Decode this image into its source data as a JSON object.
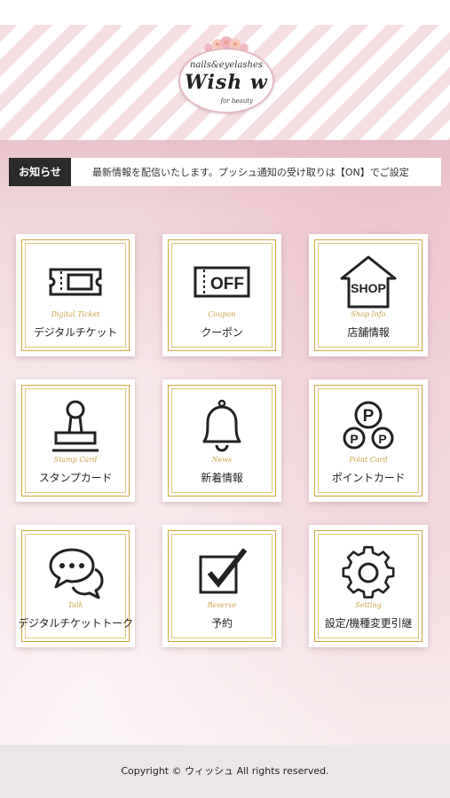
{
  "logo": {
    "small_text": "nails&eyelashes",
    "main_text": "Wish w",
    "sub_text": "for beauty"
  },
  "ticker": {
    "label": "お知らせ",
    "text": "最新情報を配信いたします。プッシュ通知の受け取りは【ON】でご設定"
  },
  "tiles": [
    {
      "en": "Digital Ticket",
      "jp": "デジタルチケット",
      "icon": "ticket-icon"
    },
    {
      "en": "Coupon",
      "jp": "クーポン",
      "icon": "off-coupon-icon",
      "icon_text": "OFF"
    },
    {
      "en": "Shop Info",
      "jp": "店舗情報",
      "icon": "shop-house-icon",
      "icon_text": "SHOP"
    },
    {
      "en": "Stamp Card",
      "jp": "スタンプカード",
      "icon": "stamp-icon"
    },
    {
      "en": "News",
      "jp": "新着情報",
      "icon": "bell-icon"
    },
    {
      "en": "Point Card",
      "jp": "ポイントカード",
      "icon": "points-icon",
      "icon_text": "P"
    },
    {
      "en": "Talk",
      "jp": "デジタルチケットトーク",
      "icon": "chat-bubbles-icon"
    },
    {
      "en": "Reserve",
      "jp": "予約",
      "icon": "checkbox-icon"
    },
    {
      "en": "Setting",
      "jp": "設定/機種変更引継",
      "icon": "gear-icon"
    }
  ],
  "footer": {
    "copyright": "Copyright © ウィッシュ All rights reserved."
  },
  "colors": {
    "stripe_pink": "#f6dfe3",
    "gold": "#cfa73f",
    "ticker_label_bg": "#2b2b2b",
    "footer_bg": "#ece7e6"
  }
}
